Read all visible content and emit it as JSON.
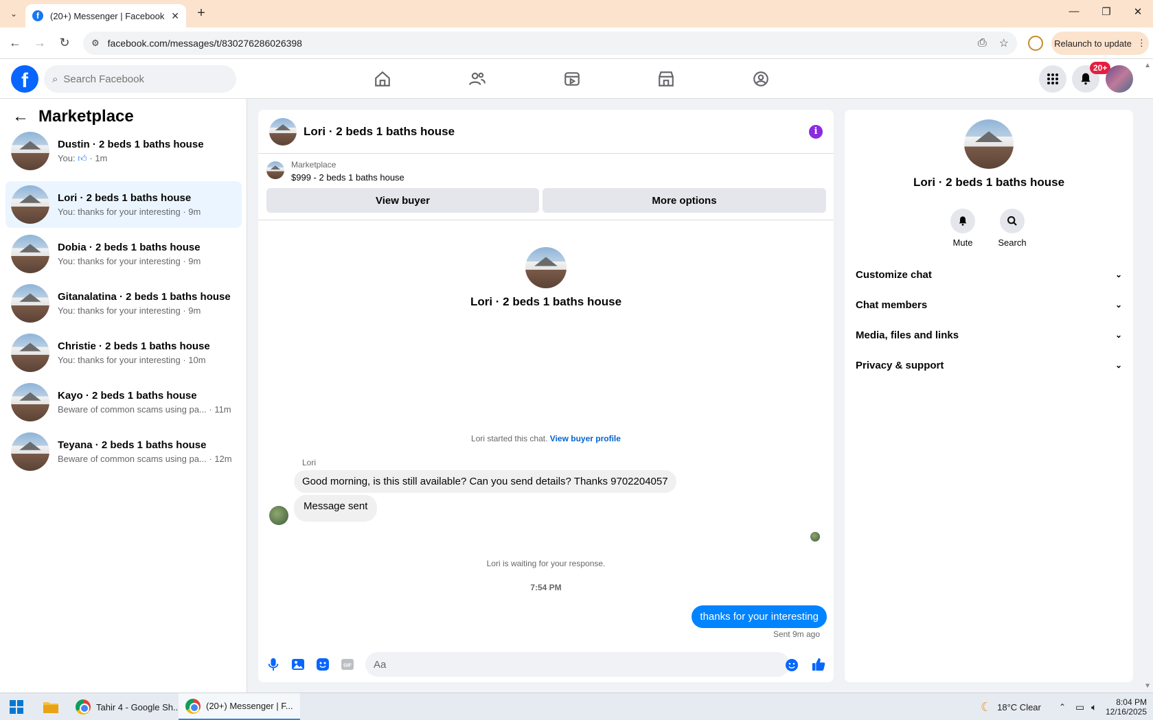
{
  "browser": {
    "tab_title": "(20+) Messenger | Facebook",
    "url": "facebook.com/messages/t/830276286026398",
    "relaunch_label": "Relaunch to update"
  },
  "header": {
    "search_placeholder": "Search Facebook",
    "notification_count": "20+"
  },
  "sidebar": {
    "title": "Marketplace",
    "conversations": [
      {
        "name": "Dustin · 2 beds 1 baths house",
        "preview": "You: ",
        "time": " · 1m"
      },
      {
        "name": "Lori · 2 beds 1 baths house",
        "preview": "You: thanks for your interesting · 9m"
      },
      {
        "name": "Dobia · 2 beds 1 baths house",
        "preview": "You: thanks for your interesting · 9m"
      },
      {
        "name": "Gitanalatina · 2 beds 1 baths house",
        "preview": "You: thanks for your interesting · 9m"
      },
      {
        "name": "Christie · 2 beds 1 baths house",
        "preview": "You: thanks for your interesting · 10m"
      },
      {
        "name": "Kayo · 2 beds 1 baths house",
        "preview": "Beware of common scams using pa... · 11m"
      },
      {
        "name": "Teyana · 2 beds 1 baths house",
        "preview": "Beware of common scams using pa... · 12m"
      }
    ]
  },
  "chat": {
    "title": "Lori · 2 beds 1 baths house",
    "marketplace_label": "Marketplace",
    "listing": "$999 - 2 beds 1 baths house",
    "view_buyer_label": "View buyer",
    "more_options_label": "More options",
    "intro_name": "Lori · 2 beds 1 baths house",
    "started_text": "Lori started this chat. ",
    "view_profile_link": "View buyer profile",
    "sender": "Lori",
    "messages_in": [
      "Good morning, is this still available? Can you send details? Thanks 9702204057",
      "Message sent"
    ],
    "waiting_text": "Lori is waiting for your response.",
    "timestamp": "7:54 PM",
    "message_out": "thanks for your interesting",
    "sent_status": "Sent 9m ago",
    "composer_placeholder": "Aa"
  },
  "panel": {
    "name": "Lori · 2 beds 1 baths house",
    "mute_label": "Mute",
    "search_label": "Search",
    "sections": [
      "Customize chat",
      "Chat members",
      "Media, files and links",
      "Privacy & support"
    ]
  },
  "taskbar": {
    "app1": "Tahir 4 - Google Sh...",
    "app2": "(20+) Messenger | F...",
    "weather": "18°C  Clear",
    "time": "8:04 PM",
    "date": "12/16/2025"
  },
  "colors": {
    "fb_blue": "#0866ff",
    "bubble_out": "#0084ff",
    "active_conv": "#ebf5ff",
    "tabbar": "#fce3cd"
  }
}
